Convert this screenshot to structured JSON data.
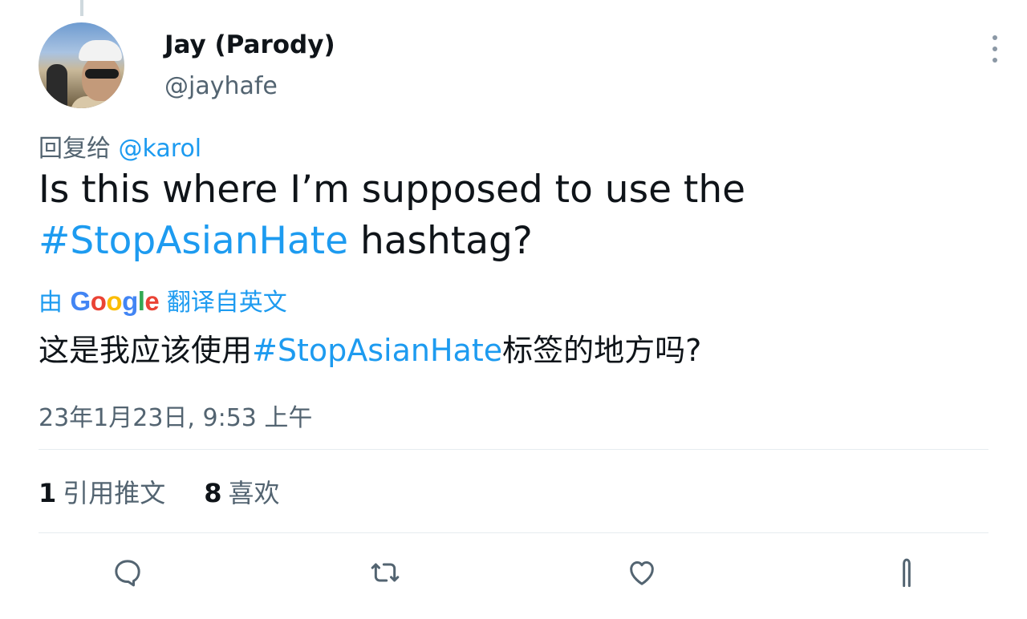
{
  "author": {
    "display_name": "Jay (Parody)",
    "handle": "@jayhafe"
  },
  "reply": {
    "prefix": "回复给",
    "mention": "@karol"
  },
  "tweet": {
    "text_before": "Is this where I’m supposed to use the ",
    "hashtag": "#StopAsianHate",
    "text_after": " hashtag?"
  },
  "translation": {
    "by_prefix": "由",
    "google": [
      "G",
      "o",
      "o",
      "g",
      "l",
      "e"
    ],
    "by_suffix": "翻译自英文",
    "text_before": "这是我应该使用",
    "hashtag": "#StopAsianHate",
    "text_after": "标签的地方吗?"
  },
  "timestamp": "23年1月23日, 9:53 上午",
  "stats": {
    "quotes_count": "1",
    "quotes_label": "引用推文",
    "likes_count": "8",
    "likes_label": "喜欢"
  },
  "actions": {
    "reply_icon": "reply-icon",
    "retweet_icon": "retweet-icon",
    "like_icon": "heart-icon",
    "share_icon": "share-icon"
  },
  "colors": {
    "link": "#1d9bf0",
    "muted": "#536471",
    "text": "#0f1419"
  }
}
